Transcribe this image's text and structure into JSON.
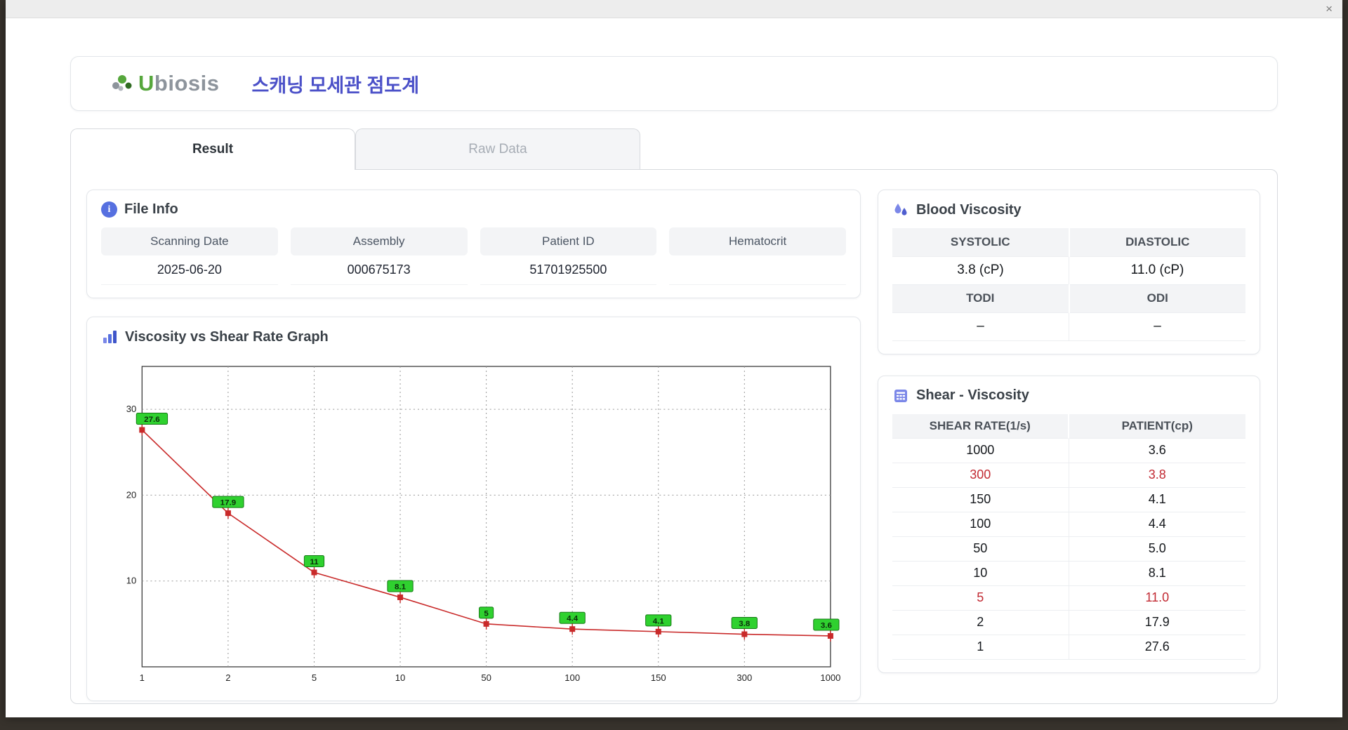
{
  "window": {
    "close_label": "×"
  },
  "header": {
    "brand_u": "U",
    "brand_rest": "biosis",
    "title": "스캐닝 모세관 점도계"
  },
  "tabs": {
    "result": "Result",
    "raw": "Raw Data"
  },
  "file_info": {
    "title": "File Info",
    "fields": [
      {
        "label": "Scanning Date",
        "value": "2025-06-20"
      },
      {
        "label": "Assembly",
        "value": "000675173"
      },
      {
        "label": "Patient ID",
        "value": "51701925500"
      },
      {
        "label": "Hematocrit",
        "value": ""
      }
    ]
  },
  "blood_viscosity": {
    "title": "Blood Viscosity",
    "head1a": "SYSTOLIC",
    "head1b": "DIASTOLIC",
    "val1a": "3.8 (cP)",
    "val1b": "11.0 (cP)",
    "head2a": "TODI",
    "head2b": "ODI",
    "val2a": "–",
    "val2b": "–"
  },
  "shear_viscosity": {
    "title": "Shear - Viscosity",
    "col1": "SHEAR RATE(1/s)",
    "col2": "PATIENT(cp)",
    "rows": [
      {
        "rate": "1000",
        "value": "3.6",
        "highlight": false
      },
      {
        "rate": "300",
        "value": "3.8",
        "highlight": true
      },
      {
        "rate": "150",
        "value": "4.1",
        "highlight": false
      },
      {
        "rate": "100",
        "value": "4.4",
        "highlight": false
      },
      {
        "rate": "50",
        "value": "5.0",
        "highlight": false
      },
      {
        "rate": "10",
        "value": "8.1",
        "highlight": false
      },
      {
        "rate": "5",
        "value": "11.0",
        "highlight": true
      },
      {
        "rate": "2",
        "value": "17.9",
        "highlight": false
      },
      {
        "rate": "1",
        "value": "27.6",
        "highlight": false
      }
    ]
  },
  "graph": {
    "title": "Viscosity vs Shear Rate Graph"
  },
  "chart_data": {
    "type": "line",
    "title": "Viscosity vs Shear Rate Graph",
    "x_ticks": [
      "1",
      "2",
      "5",
      "10",
      "50",
      "100",
      "150",
      "300",
      "1000"
    ],
    "series": [
      {
        "name": "PATIENT",
        "values": [
          27.6,
          17.9,
          11,
          8.1,
          5,
          4.4,
          4.1,
          3.8,
          3.6
        ]
      }
    ],
    "point_labels": [
      "27.6",
      "17.9",
      "11",
      "8.1",
      "5",
      "4.4",
      "4.1",
      "3.8",
      "3.6"
    ],
    "y_ticks": [
      10,
      20,
      30
    ],
    "ylim": [
      0,
      35
    ],
    "x_axis": "equal-spaced category ticks",
    "grid": "dotted",
    "legend": "none",
    "colors": {
      "line": "#c92a2a",
      "marker": "#c92a2a",
      "label_bg": "#2fd12f",
      "label_border": "#157a15"
    }
  }
}
